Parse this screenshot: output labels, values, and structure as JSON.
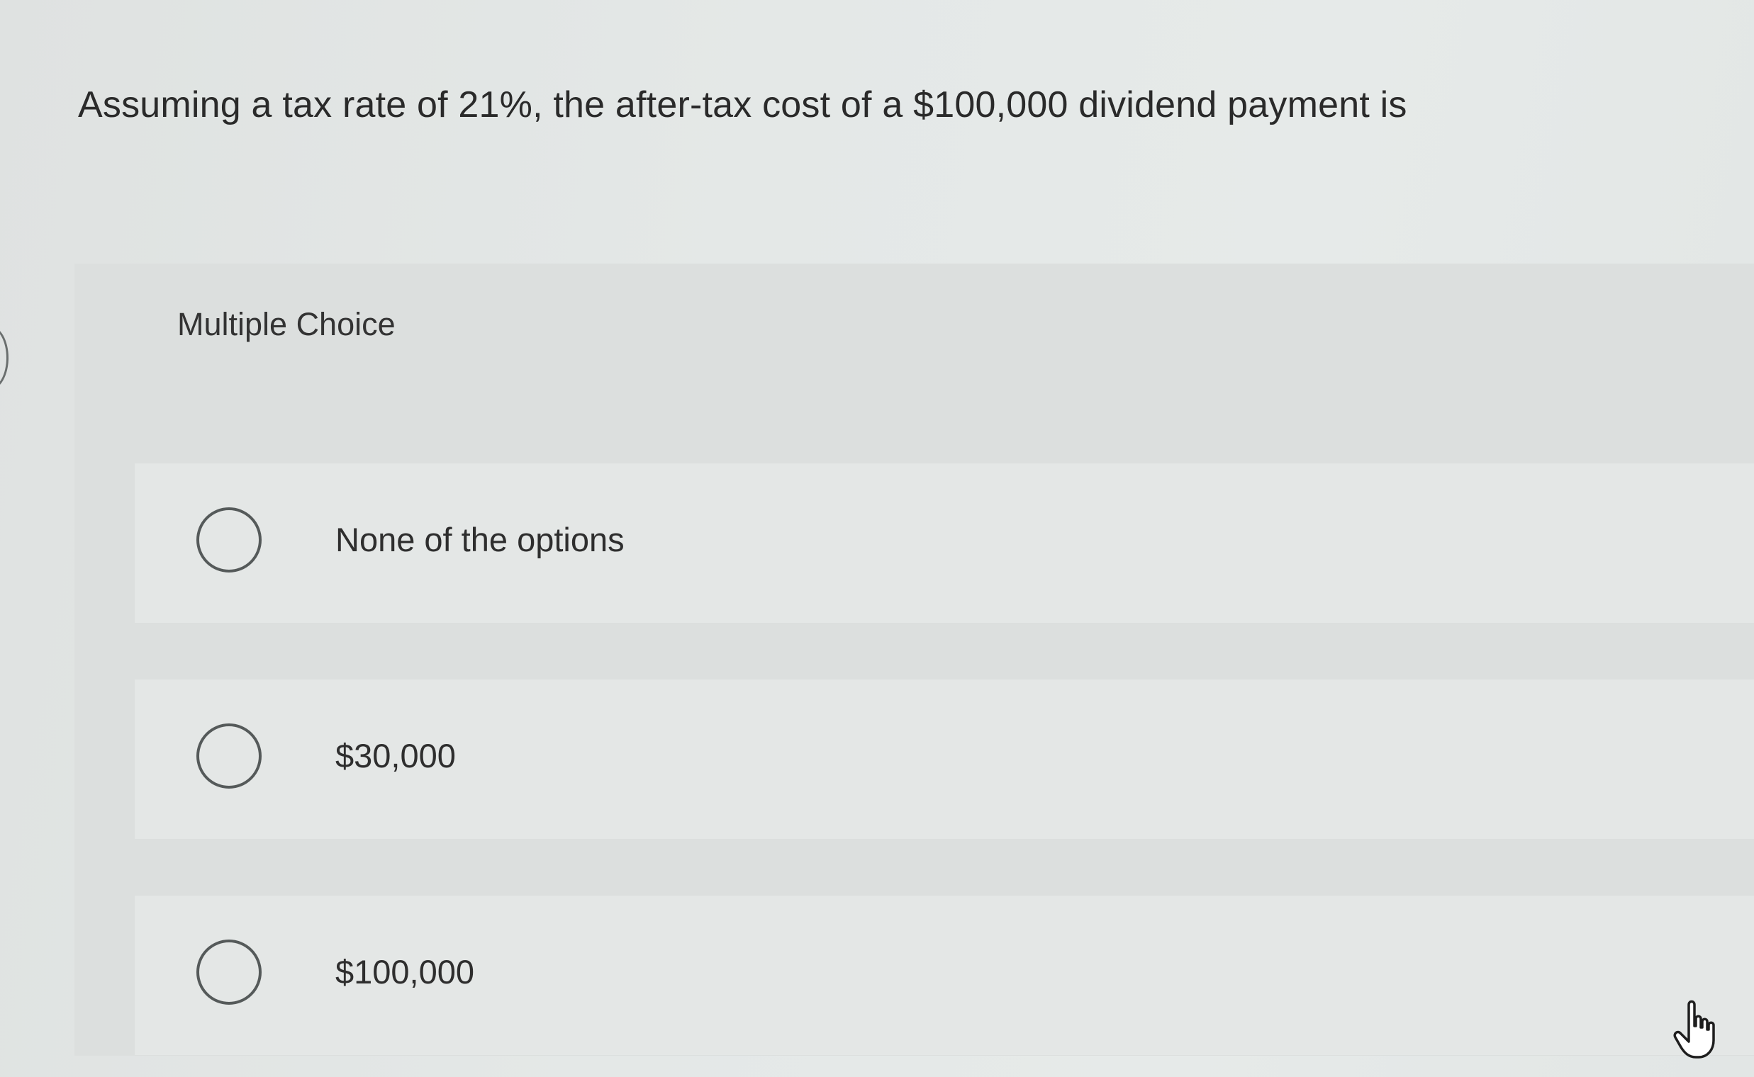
{
  "question": {
    "text": "Assuming a tax rate of 21%, the after-tax cost of a $100,000 dividend payment is"
  },
  "multiple_choice": {
    "label": "Multiple Choice",
    "options": [
      {
        "label": "None of the options",
        "selected": false
      },
      {
        "label": "$30,000",
        "selected": false
      },
      {
        "label": "$100,000",
        "selected": false
      }
    ]
  },
  "cursor": {
    "icon": "hand-pointer-icon"
  }
}
